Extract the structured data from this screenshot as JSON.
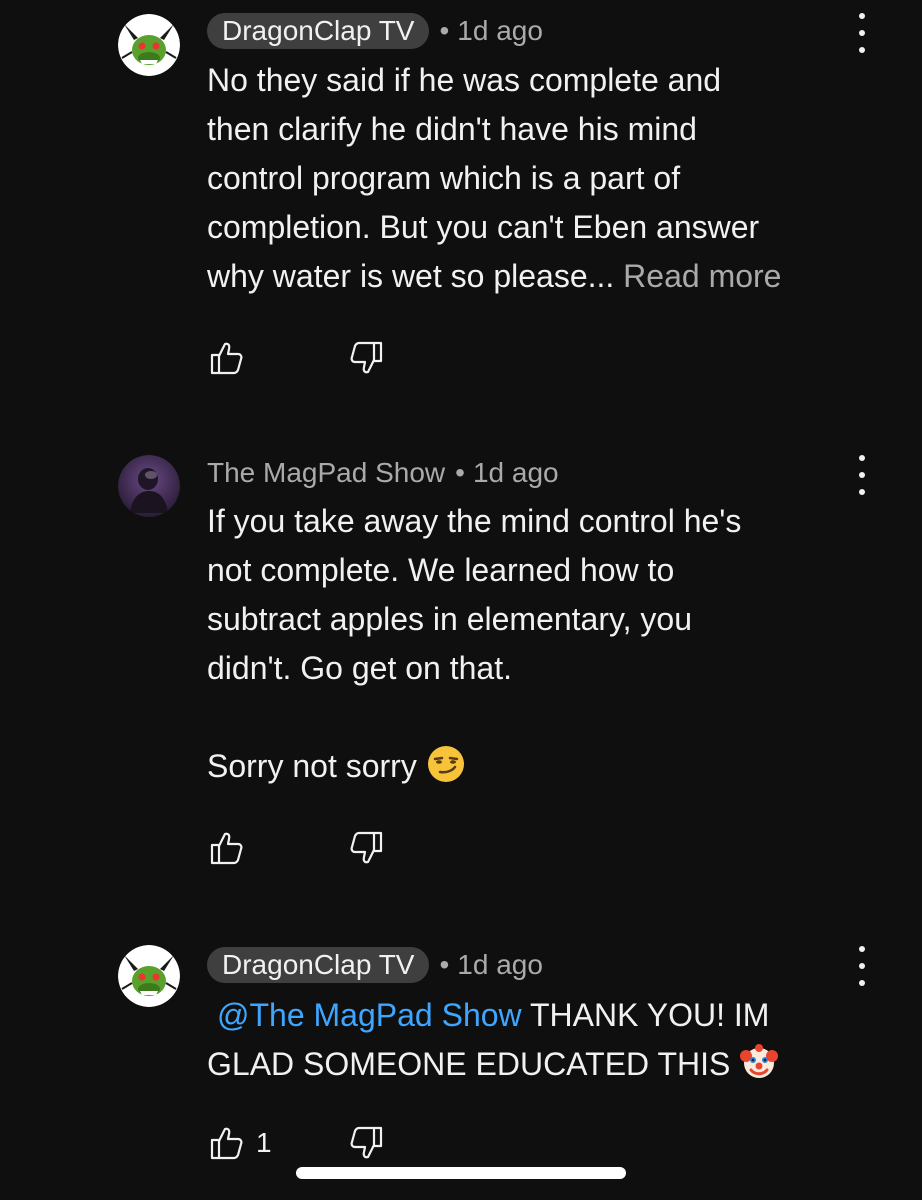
{
  "comments": [
    {
      "author": "DragonClap TV",
      "time": "1d ago",
      "text": "No they said if he was complete and\nthen clarify he didn't have his mind\ncontrol program which is a part of\ncompletion. But you can't Eben answer\nwhy water is wet so please... ",
      "read_more": "Read more"
    },
    {
      "author": "The MagPad Show",
      "time": "1d ago",
      "text": "If you take away the mind control he's\nnot complete. We learned how to\nsubtract apples in elementary, you\ndidn't. Go get on that.\n\nSorry not sorry "
    },
    {
      "author": "DragonClap TV",
      "time": "1d ago",
      "mention": "@The MagPad Show",
      "text": "  THANK YOU!  IM\nGLAD SOMEONE EDUCATED THIS ",
      "like_count": "1"
    }
  ],
  "separator": "•",
  "icons": {
    "like": "thumbs-up-icon",
    "dislike": "thumbs-down-icon",
    "more": "more-vert-icon",
    "smirk_emoji": "smirking-face-emoji",
    "clown_emoji": "clown-face-emoji"
  },
  "colors": {
    "background": "#0f0f0f",
    "text": "#f1f1f1",
    "secondary": "#aaaaaa",
    "chip": "#3f3f3f",
    "mention": "#3ea6ff"
  }
}
